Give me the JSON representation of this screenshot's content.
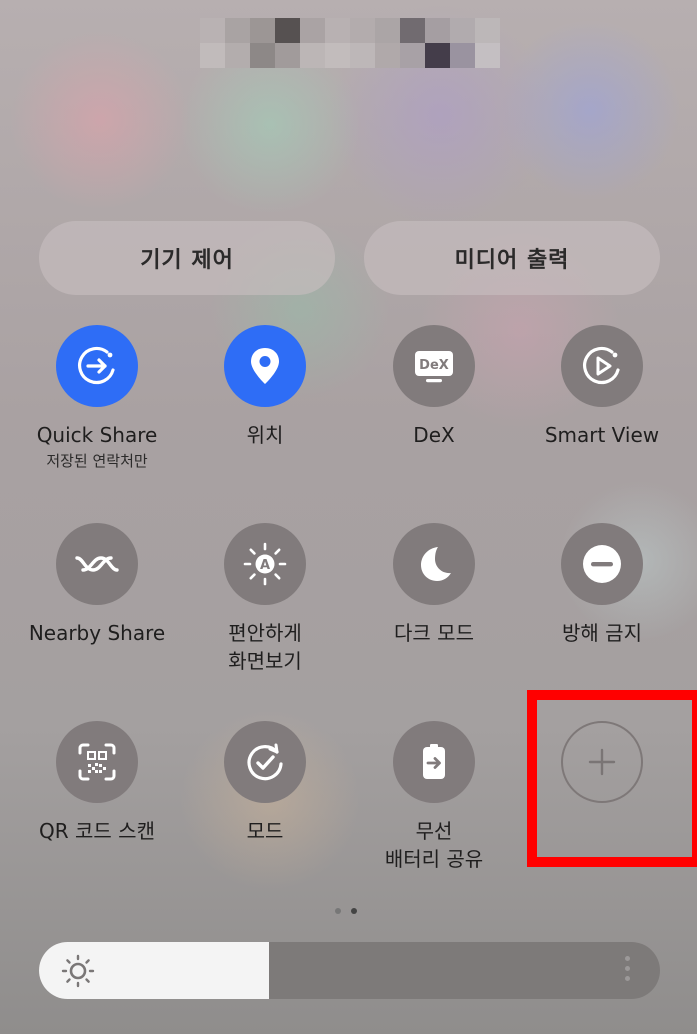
{
  "top_pills": {
    "device_control": "기기 제어",
    "media_output": "미디어 출력"
  },
  "tiles": [
    {
      "label": "Quick Share",
      "sub": "저장된 연락처만",
      "icon": "quick-share-icon",
      "state": "on"
    },
    {
      "label": "위치",
      "icon": "location-pin-icon",
      "state": "on"
    },
    {
      "label": "DeX",
      "icon": "dex-icon",
      "state": "off"
    },
    {
      "label": "Smart View",
      "icon": "smart-view-icon",
      "state": "off"
    },
    {
      "label": "Nearby Share",
      "icon": "nearby-share-icon",
      "state": "off"
    },
    {
      "label": "편안하게",
      "label2": "화면보기",
      "icon": "eye-comfort-icon",
      "state": "off"
    },
    {
      "label": "다크 모드",
      "icon": "moon-icon",
      "state": "off"
    },
    {
      "label": "방해 금지",
      "icon": "do-not-disturb-icon",
      "state": "off"
    },
    {
      "label": "QR 코드 스캔",
      "icon": "qr-scan-icon",
      "state": "off"
    },
    {
      "label": "모드",
      "icon": "modes-icon",
      "state": "off"
    },
    {
      "label": "무선",
      "label2": "배터리 공유",
      "icon": "wireless-battery-share-icon",
      "state": "off"
    },
    {
      "icon": "plus-icon",
      "state": "add"
    }
  ],
  "dex_icon_text": "DeX",
  "eye_comfort_icon_text": "A",
  "page_indicator": {
    "pages": 2,
    "current": 2
  },
  "brightness": {
    "level": 0.37,
    "icon": "sun-icon"
  },
  "colors": {
    "active_tile": "#2e6df6",
    "inactive_tile": "#817b7c",
    "highlight": "#ff0000"
  }
}
